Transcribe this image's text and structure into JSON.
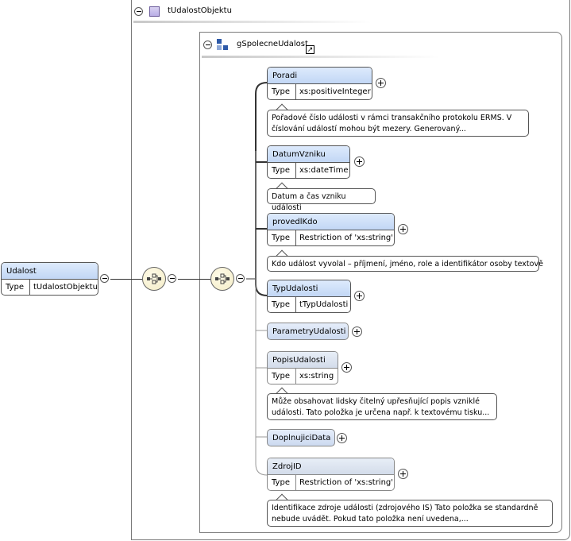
{
  "complex_type": {
    "name": "tUdalostObjektu",
    "group": {
      "name": "gSpolecneUdalost",
      "elements": [
        {
          "name": "Poradi",
          "type_label": "Type",
          "type": "xs:positiveInteger",
          "doc": [
            "Pořadové číslo události v rámci transakčního protokolu ERMS. V",
            "číslování událostí mohou být mezery. Generovaný..."
          ]
        },
        {
          "name": "DatumVzniku",
          "type_label": "Type",
          "type": "xs:dateTime",
          "doc": [
            "Datum a čas vzniku události"
          ]
        },
        {
          "name": "provedlKdo",
          "type_label": "Type",
          "type": "Restriction of 'xs:string'",
          "doc": [
            "Kdo událost vyvolal – příjmení, jméno, role a identifikátor osoby textově"
          ]
        },
        {
          "name": "TypUdalosti",
          "type_label": "Type",
          "type": "tTypUdalosti"
        },
        {
          "name": "ParametryUdalosti"
        },
        {
          "name": "PopisUdalosti",
          "type_label": "Type",
          "type": "xs:string",
          "doc": [
            "Může obsahovat lidsky čitelný upřesňující popis vzniklé",
            "události. Tato položka je určena např. k textovému tisku..."
          ]
        },
        {
          "name": "DoplnujiciData"
        },
        {
          "name": "ZdrojID",
          "type_label": "Type",
          "type": "Restriction of 'xs:string'",
          "doc": [
            "Identifikace zdroje události (zdrojového IS) Tato položka se standardně",
            "nebude uvádět. Pokud tato položka není uvedena,..."
          ]
        }
      ]
    }
  },
  "root_element": {
    "name": "Udalost",
    "type_label": "Type",
    "type": "tUdalostObjektu"
  }
}
